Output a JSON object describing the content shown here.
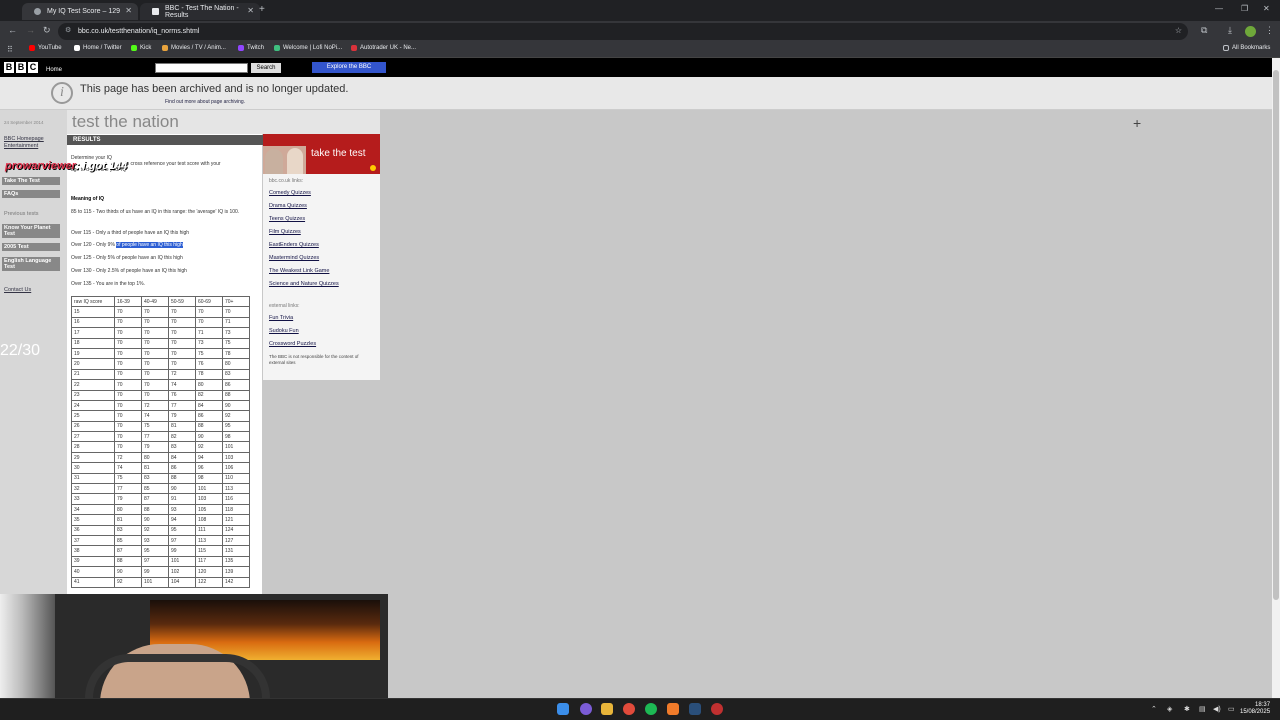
{
  "browser": {
    "tabs": [
      {
        "title": "My IQ Test Score – 129"
      },
      {
        "title": "BBC - Test The Nation - Results"
      }
    ],
    "new_tab": "+",
    "url": "bbc.co.uk/testthenation/iq_norms.shtml",
    "bookmarks": [
      {
        "label": "YouTube",
        "color": "#ff0000"
      },
      {
        "label": "Home / Twitter",
        "color": "#ffffff"
      },
      {
        "label": "Kick",
        "color": "#53fc18"
      },
      {
        "label": "Movies / TV / Anim...",
        "color": "#e8a33d"
      },
      {
        "label": "Twitch",
        "color": "#9146ff"
      },
      {
        "label": "Welcome | Lofi NoPi...",
        "color": "#3fbf7f"
      },
      {
        "label": "Autotrader UK - Ne...",
        "color": "#d9323b"
      }
    ],
    "all_bookmarks": "All Bookmarks"
  },
  "bbc_bar": {
    "logo": [
      "B",
      "B",
      "C"
    ],
    "home": "Home",
    "search_button": "Search",
    "explore": "Explore the BBC"
  },
  "archive": {
    "icon": "i",
    "message": "This page has been archived and is no longer updated.",
    "link": "Find out more about page archiving."
  },
  "leftnav": {
    "date": "24 September 2014",
    "bbc_home": "BBC Homepage",
    "entertainment": "Entertainment",
    "take_the_test": "Take The Test",
    "faqs": "FAQs",
    "previous_tests": "Previous tests",
    "know_your_planet": "Know Your Planet Test",
    "test_2005": "2005 Test",
    "english_language": "English Language Test",
    "contact_us": "Contact Us",
    "stream_counter": "22/30"
  },
  "stream_overlay": {
    "name": "prowarviewer",
    "message": ": i got 144"
  },
  "content": {
    "site_title": "test the nation",
    "results_heading": "RESULTS",
    "determine_heading": "Determine your IQ",
    "determine_text": "to cross reference your test score with your",
    "determine_text2": "age to determine your IQ",
    "meaning_heading": "Meaning of IQ",
    "iq_lines": [
      "85 to 115 - Two thirds of us have an IQ in this range: the 'average' IQ is 100.",
      "Over 115 - Only a third of people have an IQ this high"
    ],
    "over_120_prefix": "Over 120 - Only 9% ",
    "over_120_selected": "of people have an IQ this high",
    "iq_lines_after": [
      "Over 125 - Only 5% of people have an IQ this high",
      "Over 130 - Only 2.5% of people have an IQ this high",
      "Over 135 - You are in the top 1%."
    ]
  },
  "iq_table": {
    "headers": [
      "raw IQ score",
      "16-39",
      "40-49",
      "50-59",
      "60-69",
      "70+"
    ],
    "rows": [
      [
        "15",
        "70",
        "70",
        "70",
        "70",
        "70"
      ],
      [
        "16",
        "70",
        "70",
        "70",
        "70",
        "71"
      ],
      [
        "17",
        "70",
        "70",
        "70",
        "71",
        "73"
      ],
      [
        "18",
        "70",
        "70",
        "70",
        "73",
        "75"
      ],
      [
        "19",
        "70",
        "70",
        "70",
        "75",
        "78"
      ],
      [
        "20",
        "70",
        "70",
        "70",
        "76",
        "80"
      ],
      [
        "21",
        "70",
        "70",
        "72",
        "78",
        "83"
      ],
      [
        "22",
        "70",
        "70",
        "74",
        "80",
        "86"
      ],
      [
        "23",
        "70",
        "70",
        "76",
        "82",
        "88"
      ],
      [
        "24",
        "70",
        "72",
        "77",
        "84",
        "90"
      ],
      [
        "25",
        "70",
        "74",
        "79",
        "86",
        "92"
      ],
      [
        "26",
        "70",
        "75",
        "81",
        "88",
        "95"
      ],
      [
        "27",
        "70",
        "77",
        "82",
        "90",
        "98"
      ],
      [
        "28",
        "70",
        "79",
        "83",
        "92",
        "101"
      ],
      [
        "29",
        "72",
        "80",
        "84",
        "94",
        "103"
      ],
      [
        "30",
        "74",
        "81",
        "86",
        "96",
        "106"
      ],
      [
        "31",
        "75",
        "83",
        "88",
        "98",
        "110"
      ],
      [
        "32",
        "77",
        "85",
        "90",
        "101",
        "113"
      ],
      [
        "33",
        "79",
        "87",
        "91",
        "103",
        "116"
      ],
      [
        "34",
        "80",
        "88",
        "93",
        "105",
        "118"
      ],
      [
        "35",
        "81",
        "90",
        "94",
        "108",
        "121"
      ],
      [
        "36",
        "83",
        "92",
        "95",
        "111",
        "124"
      ],
      [
        "37",
        "85",
        "93",
        "97",
        "113",
        "127"
      ],
      [
        "38",
        "87",
        "95",
        "99",
        "115",
        "131"
      ],
      [
        "39",
        "88",
        "97",
        "101",
        "117",
        "135"
      ],
      [
        "40",
        "90",
        "99",
        "102",
        "120",
        "139"
      ],
      [
        "41",
        "92",
        "101",
        "104",
        "122",
        "142"
      ]
    ]
  },
  "sidebar": {
    "take_the_test": "take the test",
    "links_heading": "bbc.co.uk links:",
    "links": [
      "Comedy Quizzes",
      "Drama Quizzes",
      "Teens Quizzes",
      "Film Quizzes",
      "EastEnders Quizzes",
      "Mastermind Quizzes",
      "The Weakest Link Game",
      "Science and Nature Quizzes"
    ],
    "external_heading": "external links:",
    "external_links": [
      "Fun Trivia",
      "Sudoku Fun",
      "Crossword Puzzles"
    ],
    "disclaimer": "The BBC is not responsible for the content of external sites"
  },
  "taskbar": {
    "time": "18:37",
    "date": "15/08/2025"
  }
}
